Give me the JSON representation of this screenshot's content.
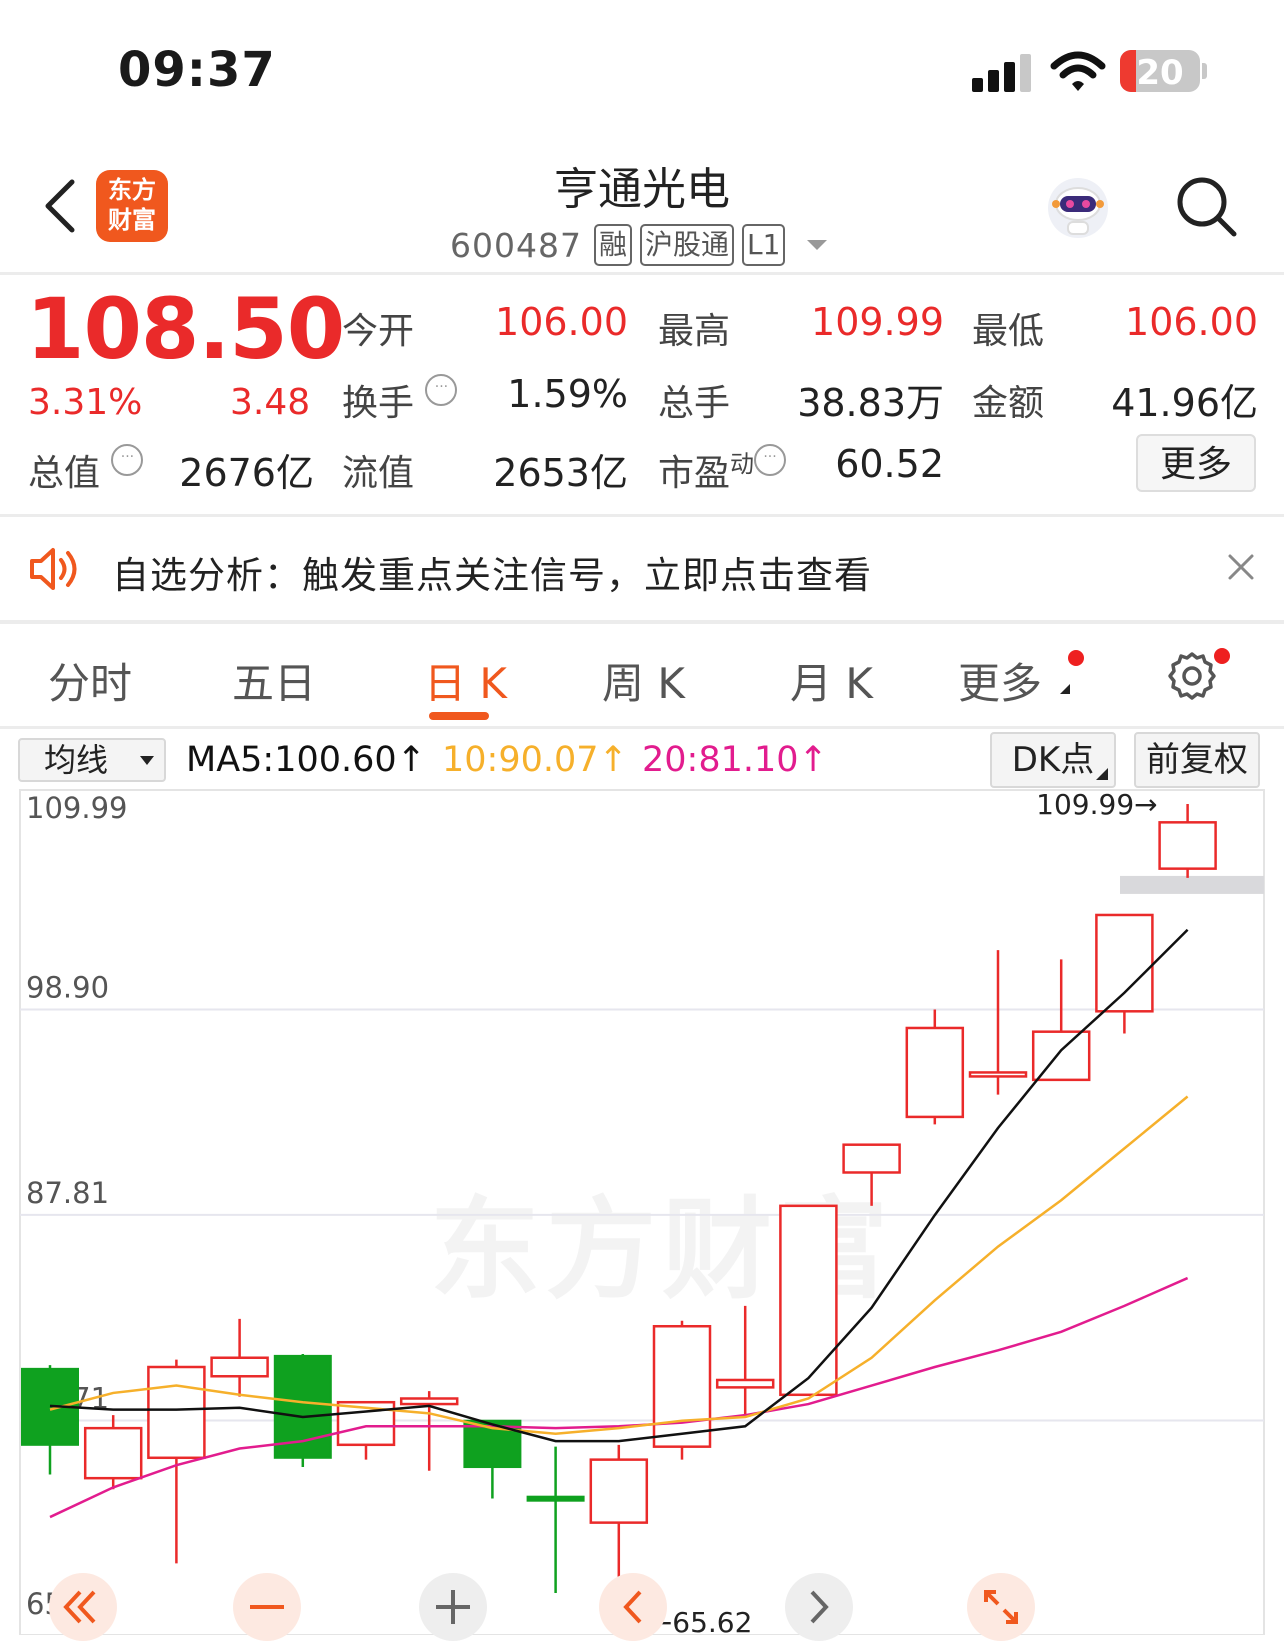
{
  "status_bar": {
    "time": "09:37",
    "battery": "20"
  },
  "header": {
    "logo_line1": "东方",
    "logo_line2": "财富",
    "name": "亨通光电",
    "code": "600487",
    "tags": [
      "融",
      "沪股通",
      "L1"
    ]
  },
  "quote": {
    "price": "108.50",
    "change_pct": "3.31%",
    "change": "3.48",
    "fields": {
      "open_label": "今开",
      "open": "106.00",
      "high_label": "最高",
      "high": "109.99",
      "low_label": "最低",
      "low": "106.00",
      "turnover_label": "换手",
      "turnover": "1.59%",
      "volume_label": "总手",
      "volume": "38.83万",
      "amount_label": "金额",
      "amount": "41.96亿",
      "mktcap_label": "总值",
      "mktcap": "2676亿",
      "float_label": "流值",
      "float": "2653亿",
      "pe_label": "市盈",
      "pe_sup": "动",
      "pe": "60.52"
    },
    "more": "更多"
  },
  "notice": {
    "text": "自选分析：触发重点关注信号，立即点击查看"
  },
  "tabs": [
    "分时",
    "五日",
    "日 K",
    "周 K",
    "月 K",
    "更多"
  ],
  "active_tab": "日 K",
  "indicator": {
    "select": "均线",
    "ma5": "MA5:100.60↑",
    "ma10": "10:90.07↑",
    "ma20": "20:81.10↑",
    "dk_button": "DK点",
    "adjust_button": "前复权"
  },
  "colors": {
    "up": "#ea2a2a",
    "down": "#0fa11f",
    "accent": "#f0581e",
    "ma5": "#111111",
    "ma10": "#f6b02b",
    "ma20": "#e21c8e"
  },
  "watermark": "东方财富",
  "chart_data": {
    "type": "candlestick",
    "y_ticks": [
      "109.99",
      "98.90",
      "87.81",
      "76.71",
      "65.62"
    ],
    "ylim": [
      65.62,
      109.99
    ],
    "max_label": "109.99→",
    "min_label": "←65.62",
    "candles": [
      {
        "o": 79.5,
        "c": 75.4,
        "h": 79.7,
        "l": 73.8
      },
      {
        "o": 73.6,
        "c": 76.3,
        "h": 77.0,
        "l": 73.0
      },
      {
        "o": 74.7,
        "c": 79.6,
        "h": 80.0,
        "l": 69.0
      },
      {
        "o": 79.1,
        "c": 80.1,
        "h": 82.2,
        "l": 78.0
      },
      {
        "o": 80.2,
        "c": 74.7,
        "h": 80.3,
        "l": 74.2
      },
      {
        "o": 75.4,
        "c": 77.7,
        "h": 77.7,
        "l": 74.6
      },
      {
        "o": 77.6,
        "c": 77.9,
        "h": 78.3,
        "l": 74.0
      },
      {
        "o": 76.7,
        "c": 74.2,
        "h": 76.7,
        "l": 72.5
      },
      {
        "o": 72.6,
        "c": 72.4,
        "h": 75.3,
        "l": 67.4
      },
      {
        "o": 71.2,
        "c": 74.6,
        "h": 75.4,
        "l": 65.62
      },
      {
        "o": 75.3,
        "c": 81.8,
        "h": 82.1,
        "l": 74.6
      },
      {
        "o": 78.5,
        "c": 78.9,
        "h": 82.9,
        "l": 77.0
      },
      {
        "o": 78.1,
        "c": 88.3,
        "h": 88.3,
        "l": 78.1
      },
      {
        "o": 90.1,
        "c": 91.6,
        "h": 91.6,
        "l": 88.3
      },
      {
        "o": 93.1,
        "c": 97.9,
        "h": 98.9,
        "l": 92.7
      },
      {
        "o": 95.5,
        "c": 95.5,
        "h": 102.1,
        "l": 94.3
      },
      {
        "o": 95.1,
        "c": 97.7,
        "h": 101.6,
        "l": 95.1
      },
      {
        "o": 98.8,
        "c": 104.0,
        "h": 104.0,
        "l": 97.6
      },
      {
        "o": 106.5,
        "c": 109.0,
        "h": 109.99,
        "l": 106.0
      }
    ],
    "ma5": [
      77.5,
      77.3,
      77.3,
      77.4,
      76.9,
      77.2,
      77.5,
      76.5,
      75.6,
      75.6,
      76.0,
      76.4,
      79.0,
      82.8,
      87.8,
      92.5,
      96.7,
      99.8,
      103.2
    ],
    "ma10": [
      77.3,
      78.2,
      78.6,
      78.1,
      77.7,
      77.4,
      77.1,
      76.3,
      76.0,
      76.3,
      76.7,
      76.9,
      77.9,
      80.1,
      83.2,
      86.1,
      88.6,
      91.4,
      94.2
    ],
    "ma20": [
      71.5,
      73.1,
      74.3,
      75.2,
      75.6,
      76.4,
      76.4,
      76.4,
      76.3,
      76.4,
      76.6,
      77.0,
      77.6,
      78.6,
      79.6,
      80.5,
      81.5,
      82.9,
      84.4
    ],
    "grid": true
  }
}
